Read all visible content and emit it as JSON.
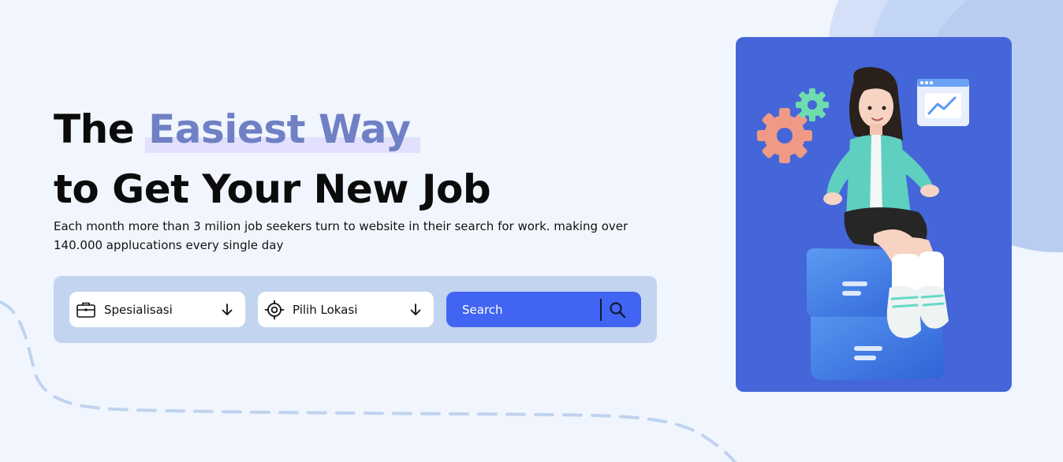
{
  "hero": {
    "title_prefix": "The",
    "title_highlight": "Easiest Way",
    "title_line2": "to Get Your New Job",
    "description": "Each month more than 3 milion job seekers turn to website in their search for work. making over 140.000 applucations every single day"
  },
  "search": {
    "specialization_label": "Spesialisasi",
    "location_label": "Pilih Lokasi",
    "search_button_label": "Search",
    "icons": {
      "specialization": "briefcase-icon",
      "location": "crosshair-icon",
      "dropdown": "arrow-down-icon",
      "search": "magnifier-icon"
    }
  },
  "colors": {
    "page_background": "#f1f6fe",
    "highlight_text": "#6f80c4",
    "highlight_bar": "#e3e0fd",
    "search_panel": "#c3d4f0",
    "search_button": "#4164f2",
    "hero_card": "#4466d8"
  }
}
